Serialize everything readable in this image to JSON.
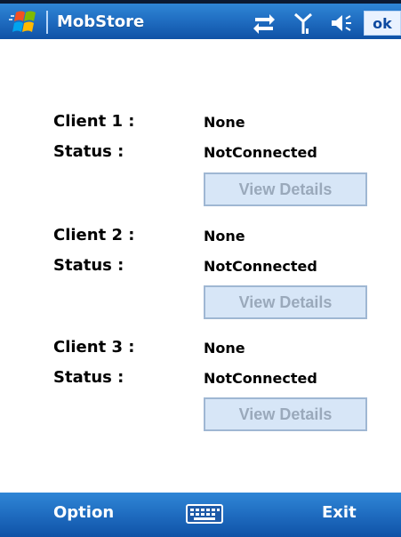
{
  "topbar": {
    "title": "MobStore",
    "ok_label": "ok",
    "icons": [
      "windows-start-icon",
      "data-transfer-icon",
      "signal-icon",
      "volume-icon"
    ]
  },
  "clients": [
    {
      "client_label": "Client 1 :",
      "client_value": "None",
      "status_label": "Status :",
      "status_value": "NotConnected",
      "button_label": "View Details"
    },
    {
      "client_label": "Client 2 :",
      "client_value": "None",
      "status_label": "Status :",
      "status_value": "NotConnected",
      "button_label": "View Details"
    },
    {
      "client_label": "Client 3 :",
      "client_value": "None",
      "status_label": "Status :",
      "status_value": "NotConnected",
      "button_label": "View Details"
    }
  ],
  "bottombar": {
    "left_softkey": "Option",
    "right_softkey": "Exit",
    "center_icon": "keyboard-icon"
  },
  "colors": {
    "bar_blue": "#1f6cc0",
    "button_bg": "#d7e6f7",
    "button_border": "#9fb7d3",
    "button_text_disabled": "#9aa9bb"
  }
}
